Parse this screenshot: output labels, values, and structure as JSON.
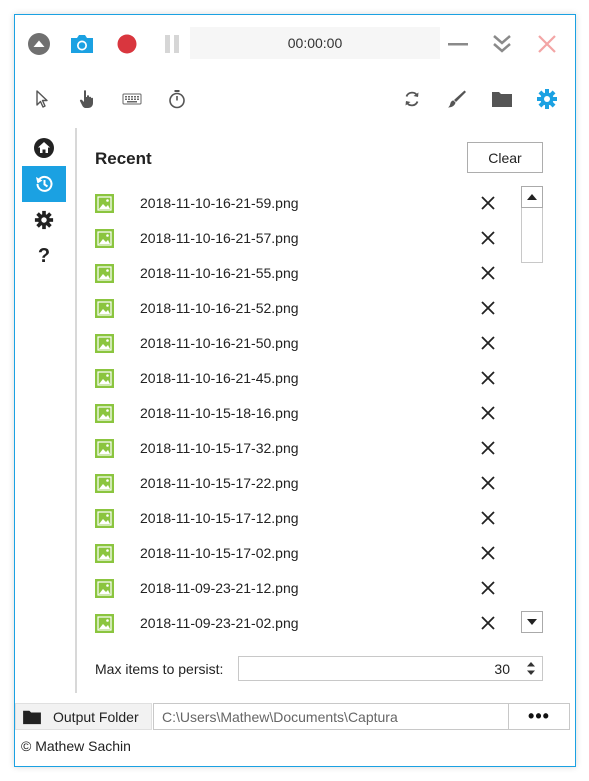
{
  "titlebar": {
    "timer": "00:00:00",
    "icons": [
      "collapse-icon",
      "screenshot-icon",
      "record-icon",
      "pause-icon",
      "minimize-icon",
      "minimize-to-tray-icon",
      "close-icon"
    ]
  },
  "toolbar": {
    "icons": [
      "cursor-icon",
      "click-icon",
      "keystrokes-icon",
      "timer-icon",
      "refresh-icon",
      "brush-icon",
      "folder-icon",
      "settings-icon"
    ]
  },
  "sidenav": {
    "items": [
      "home",
      "recent",
      "settings",
      "about"
    ],
    "active": "recent",
    "about_label": "?"
  },
  "recent": {
    "title": "Recent",
    "clear_label": "Clear",
    "items": [
      "2018-11-10-16-21-59.png",
      "2018-11-10-16-21-57.png",
      "2018-11-10-16-21-55.png",
      "2018-11-10-16-21-52.png",
      "2018-11-10-16-21-50.png",
      "2018-11-10-16-21-45.png",
      "2018-11-10-15-18-16.png",
      "2018-11-10-15-17-32.png",
      "2018-11-10-15-17-22.png",
      "2018-11-10-15-17-12.png",
      "2018-11-10-15-17-02.png",
      "2018-11-09-23-21-12.png",
      "2018-11-09-23-21-02.png"
    ],
    "persist_label": "Max items to persist:",
    "persist_value": "30"
  },
  "output": {
    "label": "Output Folder",
    "path": "C:\\Users\\Mathew\\Documents\\Captura",
    "more_label": "•••"
  },
  "footer": {
    "copyright": "© Mathew Sachin"
  },
  "colors": {
    "accent": "#1ba1e2",
    "record": "#d9363e",
    "image_icon": "#8bc53f",
    "close_disabled": "#f3a5a5"
  }
}
